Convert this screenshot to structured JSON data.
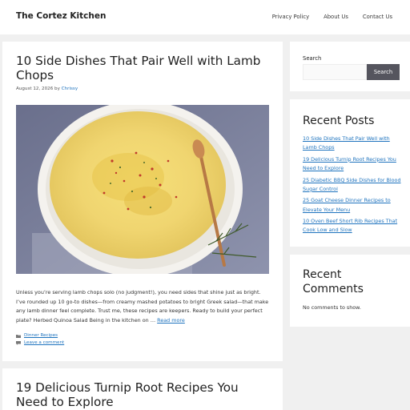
{
  "site": {
    "title": "The Cortez Kitchen",
    "nav": [
      "Privacy Policy",
      "About Us",
      "Contact Us"
    ]
  },
  "posts": [
    {
      "title": "10 Side Dishes That Pair Well with Lamb Chops",
      "date": "August 12, 2026",
      "by": "by",
      "author": "Chrissy",
      "excerpt": "Unless you’re serving lamb chops solo (no judgment!), you need sides that shine just as bright. I’ve rounded up 10 go-to dishes—from creamy mashed potatoes to bright Greek salad—that make any lamb dinner feel complete. Trust me, these recipes are keepers. Ready to build your perfect plate? Herbed Quinoa Salad Being in the kitchen on …",
      "read_more": "Read more",
      "category": "Dinner Recipes",
      "comment_link": "Leave a comment"
    },
    {
      "title": "19 Delicious Turnip Root Recipes You Need to Explore"
    }
  ],
  "sidebar": {
    "search_label": "Search",
    "search_button": "Search",
    "recent_posts_title": "Recent Posts",
    "recent_posts": [
      "10 Side Dishes That Pair Well with Lamb Chops",
      "19 Delicious Turnip Root Recipes You Need to Explore",
      "25 Diabetic BBQ Side Dishes for Blood Sugar Control",
      "25 Goat Cheese Dinner Recipes to Elevate Your Menu",
      "10 Oven Beef Short Rib Recipes That Cook Low and Slow"
    ],
    "recent_comments_title": "Recent Comments",
    "no_comments": "No comments to show."
  },
  "icons": {
    "category": "folder-icon",
    "comment": "comment-icon"
  },
  "colors": {
    "link": "#1e73be",
    "search_button": "#55555e",
    "background": "#f0f0f0"
  }
}
